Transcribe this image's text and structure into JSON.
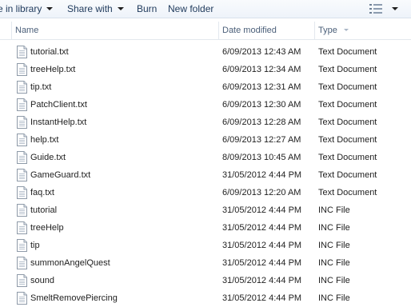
{
  "toolbar": {
    "library_label": "e in library",
    "share_label": "Share with",
    "burn_label": "Burn",
    "new_folder_label": "New folder"
  },
  "columns": {
    "name": "Name",
    "date": "Date modified",
    "type": "Type"
  },
  "files": [
    {
      "name": "tutorial.txt",
      "date": "6/09/2013 12:43 AM",
      "type": "Text Document"
    },
    {
      "name": "treeHelp.txt",
      "date": "6/09/2013 12:34 AM",
      "type": "Text Document"
    },
    {
      "name": "tip.txt",
      "date": "6/09/2013 12:31 AM",
      "type": "Text Document"
    },
    {
      "name": "PatchClient.txt",
      "date": "6/09/2013 12:30 AM",
      "type": "Text Document"
    },
    {
      "name": "InstantHelp.txt",
      "date": "6/09/2013 12:28 AM",
      "type": "Text Document"
    },
    {
      "name": "help.txt",
      "date": "6/09/2013 12:27 AM",
      "type": "Text Document"
    },
    {
      "name": "Guide.txt",
      "date": "8/09/2013 10:45 AM",
      "type": "Text Document"
    },
    {
      "name": "GameGuard.txt",
      "date": "31/05/2012 4:44 PM",
      "type": "Text Document"
    },
    {
      "name": "faq.txt",
      "date": "6/09/2013 12:20 AM",
      "type": "Text Document"
    },
    {
      "name": "tutorial",
      "date": "31/05/2012 4:44 PM",
      "type": "INC File"
    },
    {
      "name": "treeHelp",
      "date": "31/05/2012 4:44 PM",
      "type": "INC File"
    },
    {
      "name": "tip",
      "date": "31/05/2012 4:44 PM",
      "type": "INC File"
    },
    {
      "name": "summonAngelQuest",
      "date": "31/05/2012 4:44 PM",
      "type": "INC File"
    },
    {
      "name": "sound",
      "date": "31/05/2012 4:44 PM",
      "type": "INC File"
    },
    {
      "name": "SmeltRemovePiercing",
      "date": "31/05/2012 4:44 PM",
      "type": "INC File"
    }
  ],
  "icons": {
    "file": "document-icon",
    "view": "view-details-icon"
  },
  "colors": {
    "toolbar_text": "#1e395b",
    "header_text": "#4c607a",
    "text": "#1e1e1e"
  }
}
